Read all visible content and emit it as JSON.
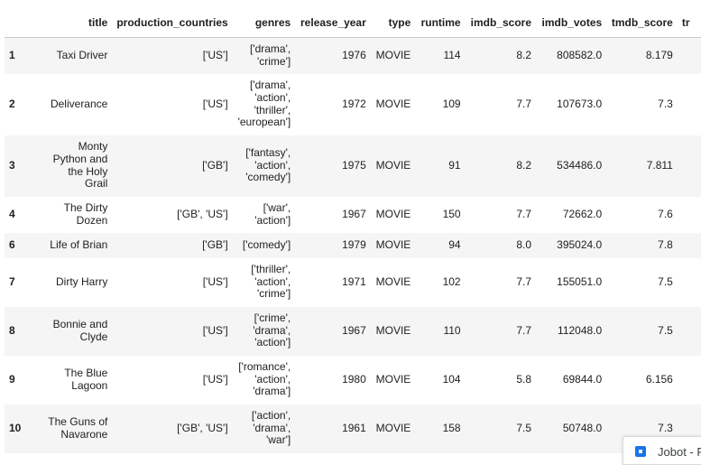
{
  "table": {
    "columns": [
      "",
      "title",
      "production_countries",
      "genres",
      "release_year",
      "type",
      "runtime",
      "imdb_score",
      "imdb_votes",
      "tmdb_score",
      "tr"
    ],
    "rows": [
      {
        "index": "1",
        "title": [
          "Taxi Driver"
        ],
        "production_countries": "['US']",
        "genres": [
          "['drama',",
          "'crime']"
        ],
        "release_year": "1976",
        "type": "MOVIE",
        "runtime": "114",
        "imdb_score": "8.2",
        "imdb_votes": "808582.0",
        "tmdb_score": "8.179"
      },
      {
        "index": "2",
        "title": [
          "Deliverance"
        ],
        "production_countries": "['US']",
        "genres": [
          "['drama',",
          "'action',",
          "'thriller',",
          "'european']"
        ],
        "release_year": "1972",
        "type": "MOVIE",
        "runtime": "109",
        "imdb_score": "7.7",
        "imdb_votes": "107673.0",
        "tmdb_score": "7.3"
      },
      {
        "index": "3",
        "title": [
          "Monty",
          "Python and",
          "the Holy",
          "Grail"
        ],
        "production_countries": "['GB']",
        "genres": [
          "['fantasy',",
          "'action',",
          "'comedy']"
        ],
        "release_year": "1975",
        "type": "MOVIE",
        "runtime": "91",
        "imdb_score": "8.2",
        "imdb_votes": "534486.0",
        "tmdb_score": "7.811"
      },
      {
        "index": "4",
        "title": [
          "The Dirty",
          "Dozen"
        ],
        "production_countries": "['GB', 'US']",
        "genres": [
          "['war',",
          "'action']"
        ],
        "release_year": "1967",
        "type": "MOVIE",
        "runtime": "150",
        "imdb_score": "7.7",
        "imdb_votes": "72662.0",
        "tmdb_score": "7.6"
      },
      {
        "index": "6",
        "title": [
          "Life of Brian"
        ],
        "production_countries": "['GB']",
        "genres": [
          "['comedy']"
        ],
        "release_year": "1979",
        "type": "MOVIE",
        "runtime": "94",
        "imdb_score": "8.0",
        "imdb_votes": "395024.0",
        "tmdb_score": "7.8"
      },
      {
        "index": "7",
        "title": [
          "Dirty Harry"
        ],
        "production_countries": "['US']",
        "genres": [
          "['thriller',",
          "'action',",
          "'crime']"
        ],
        "release_year": "1971",
        "type": "MOVIE",
        "runtime": "102",
        "imdb_score": "7.7",
        "imdb_votes": "155051.0",
        "tmdb_score": "7.5"
      },
      {
        "index": "8",
        "title": [
          "Bonnie and",
          "Clyde"
        ],
        "production_countries": "['US']",
        "genres": [
          "['crime',",
          "'drama',",
          "'action']"
        ],
        "release_year": "1967",
        "type": "MOVIE",
        "runtime": "110",
        "imdb_score": "7.7",
        "imdb_votes": "112048.0",
        "tmdb_score": "7.5"
      },
      {
        "index": "9",
        "title": [
          "The Blue",
          "Lagoon"
        ],
        "production_countries": "['US']",
        "genres": [
          "['romance',",
          "'action',",
          "'drama']"
        ],
        "release_year": "1980",
        "type": "MOVIE",
        "runtime": "104",
        "imdb_score": "5.8",
        "imdb_votes": "69844.0",
        "tmdb_score": "6.156"
      },
      {
        "index": "10",
        "title": [
          "The Guns of",
          "Navarone"
        ],
        "production_countries": "['GB', 'US']",
        "genres": [
          "['action',",
          "'drama',",
          "'war']"
        ],
        "release_year": "1961",
        "type": "MOVIE",
        "runtime": "158",
        "imdb_score": "7.5",
        "imdb_votes": "50748.0",
        "tmdb_score": "7.3"
      }
    ]
  },
  "toast": {
    "text": "Jobot - F",
    "icon": "app-icon"
  }
}
